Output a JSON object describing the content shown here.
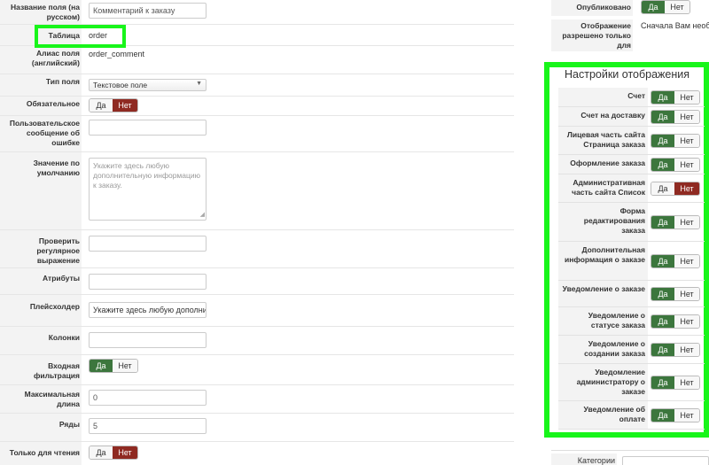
{
  "fields": {
    "name_ru": {
      "label": "Название поля (на русском)",
      "value": "Комментарий к заказу"
    },
    "table": {
      "label": "Таблица",
      "value": "order"
    },
    "alias": {
      "label": "Алиас поля (английский)",
      "value": "order_comment"
    },
    "type": {
      "label": "Тип поля",
      "value": "Текстовое поле"
    },
    "required": {
      "label": "Обязательное",
      "yes": "Да",
      "no": "Нет",
      "selected": "no"
    },
    "error_msg": {
      "label": "Пользовательское сообщение об ошибке",
      "value": ""
    },
    "default": {
      "label": "Значение по умолчанию",
      "placeholder": "Укажите здесь любую дополнительную информацию к заказу."
    },
    "regex": {
      "label": "Проверить регулярное выражение",
      "value": ""
    },
    "attributes": {
      "label": "Атрибуты",
      "value": ""
    },
    "placeholder": {
      "label": "Плейсхолдер",
      "value": "Укажите здесь любую дополните"
    },
    "columns": {
      "label": "Колонки",
      "value": ""
    },
    "input_filter": {
      "label": "Входная фильтрация",
      "yes": "Да",
      "no": "Нет",
      "selected": "yes"
    },
    "max_length": {
      "label": "Максимальная длина",
      "value": "0"
    },
    "rows": {
      "label": "Ряды",
      "value": "5"
    },
    "readonly": {
      "label": "Только для чтения",
      "yes": "Да",
      "no": "Нет",
      "selected": "no"
    }
  },
  "right": {
    "published": {
      "label": "Опубликовано",
      "yes": "Да",
      "no": "Нет",
      "selected": "yes"
    },
    "display_allowed": {
      "label": "Отображение разрешено только для",
      "value": "Сначала Вам необх"
    },
    "categories": {
      "label": "Категории"
    }
  },
  "display_settings": {
    "title": "Настройки отображения",
    "items": [
      {
        "label": "Счет",
        "yes": "Да",
        "no": "Нет",
        "selected": "yes"
      },
      {
        "label": "Счет на доставку",
        "yes": "Да",
        "no": "Нет",
        "selected": "yes"
      },
      {
        "label": "Лицевая часть сайта Страница заказа",
        "yes": "Да",
        "no": "Нет",
        "selected": "yes"
      },
      {
        "label": "Оформление заказа",
        "yes": "Да",
        "no": "Нет",
        "selected": "yes"
      },
      {
        "label": "Административная часть сайта Список",
        "yes": "Да",
        "no": "Нет",
        "selected": "no"
      },
      {
        "label": "Форма редактирования заказа",
        "yes": "Да",
        "no": "Нет",
        "selected": "yes"
      },
      {
        "label": "Дополнительная информация о заказе",
        "yes": "Да",
        "no": "Нет",
        "selected": "yes"
      },
      {
        "label": "Уведомление о заказе",
        "yes": "Да",
        "no": "Нет",
        "selected": "yes"
      },
      {
        "label": "Уведомление о статусе заказа",
        "yes": "Да",
        "no": "Нет",
        "selected": "yes"
      },
      {
        "label": "Уведомление о создании заказа",
        "yes": "Да",
        "no": "Нет",
        "selected": "yes"
      },
      {
        "label": "Уведомление администратору о заказе",
        "yes": "Да",
        "no": "Нет",
        "selected": "yes"
      },
      {
        "label": "Уведомление об оплате",
        "yes": "Да",
        "no": "Нет",
        "selected": "yes"
      }
    ]
  },
  "colors": {
    "highlight": "#18f51a",
    "yes_active": "#3c763d",
    "no_active": "#8f2a22"
  }
}
